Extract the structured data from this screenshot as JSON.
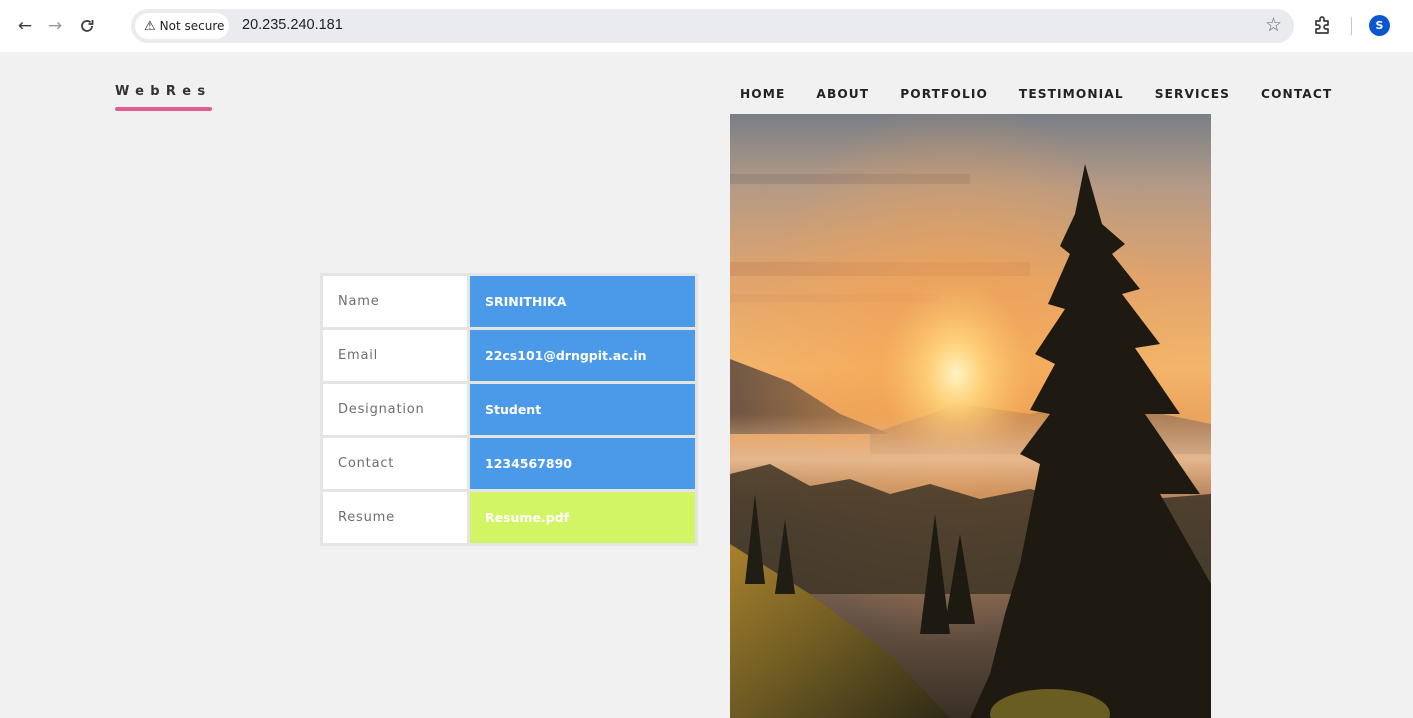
{
  "browser": {
    "security_label": "Not secure",
    "url": "20.235.240.181",
    "profile_initial": "S"
  },
  "site": {
    "logo": "WebRes",
    "nav": [
      "HOME",
      "ABOUT",
      "PORTFOLIO",
      "TESTIMONIAL",
      "SERVICES",
      "CONTACT"
    ]
  },
  "profile": {
    "rows": [
      {
        "label": "Name",
        "value": "SRINITHIKA"
      },
      {
        "label": "Email",
        "value": "22cs101@drngpit.ac.in"
      },
      {
        "label": "Designation",
        "value": "Student"
      },
      {
        "label": "Contact",
        "value": "1234567890"
      },
      {
        "label": "Resume",
        "value": "Resume.pdf"
      }
    ]
  },
  "colors": {
    "accent_blue": "#4a9ae9",
    "resume_green": "#d1f564",
    "logo_underline": "#e05d8f",
    "page_bg": "#f1f1f1"
  }
}
